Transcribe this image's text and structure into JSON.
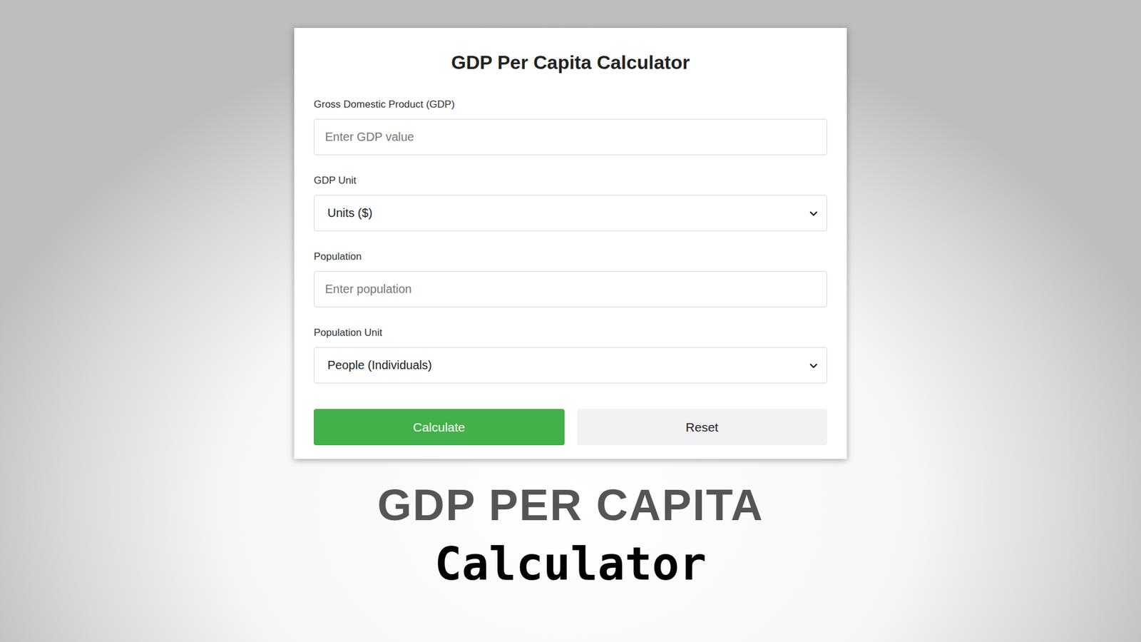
{
  "calculator": {
    "title": "GDP Per Capita Calculator",
    "fields": [
      {
        "label": "Gross Domestic Product (GDP)",
        "kind": "input",
        "placeholder": "Enter GDP value"
      },
      {
        "label": "GDP Unit",
        "kind": "select",
        "value": "Units ($)"
      },
      {
        "label": "Population",
        "kind": "input",
        "placeholder": "Enter population"
      },
      {
        "label": "Population Unit",
        "kind": "select",
        "value": "People (Individuals)"
      }
    ],
    "buttons": [
      {
        "label": "Calculate",
        "kind": "primary"
      },
      {
        "label": "Reset",
        "kind": "secondary"
      }
    ]
  },
  "banner": {
    "headline": "GDP PER CAPITA",
    "subline": "Calculator"
  }
}
